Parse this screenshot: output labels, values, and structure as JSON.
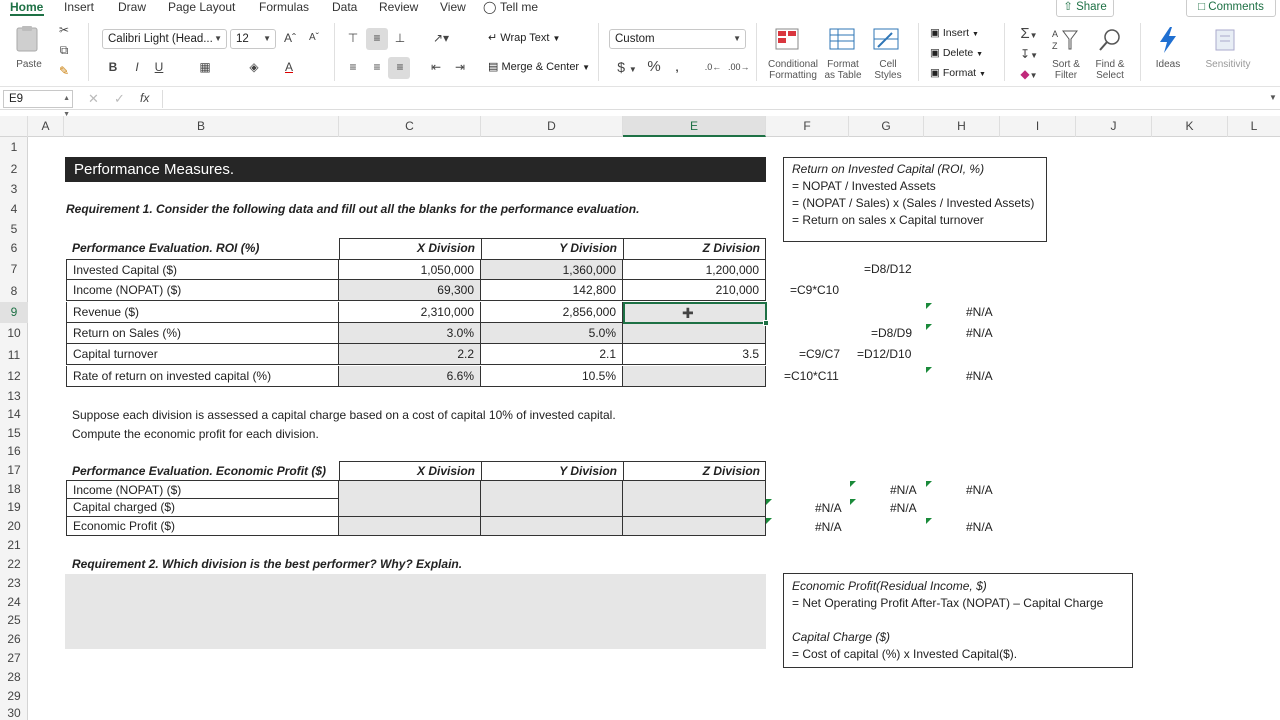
{
  "ribbon_tabs": [
    "Home",
    "Insert",
    "Draw",
    "Page Layout",
    "Formulas",
    "Data",
    "Review",
    "View",
    "Tell me"
  ],
  "share_label": "Share",
  "comments_label": "Comments",
  "ribbon": {
    "paste": "Paste",
    "font_name": "Calibri Light (Head...",
    "font_size": "12",
    "wrap_text": "Wrap Text",
    "merge_center": "Merge & Center",
    "number_format": "Custom",
    "conditional_formatting": [
      "Conditional",
      "Formatting"
    ],
    "format_as_table": [
      "Format",
      "as Table"
    ],
    "cell_styles": [
      "Cell",
      "Styles"
    ],
    "insert": "Insert",
    "delete": "Delete",
    "format": "Format",
    "sort_filter": [
      "Sort &",
      "Filter"
    ],
    "find_select": [
      "Find &",
      "Select"
    ],
    "ideas": "Ideas",
    "sensitivity": "Sensitivity"
  },
  "formula_bar": {
    "name_box": "E9",
    "fx": "fx",
    "content": ""
  },
  "columns": [
    "A",
    "B",
    "C",
    "D",
    "E",
    "F",
    "G",
    "H",
    "I",
    "J",
    "K",
    "L"
  ],
  "selected_column": "E",
  "selected_row": 9,
  "sheet": {
    "title": "Performance Measures.",
    "req1": "Requirement 1. Consider the following data and fill out all the blanks for the performance evaluation.",
    "roi_table": {
      "header": "Performance Evaluation. ROI (%)",
      "cols": [
        "X Division",
        "Y Division",
        "Z Division"
      ],
      "rows": [
        {
          "label": "Invested Capital ($)",
          "vals": [
            "1,050,000",
            "1,360,000",
            "1,200,000"
          ]
        },
        {
          "label": "Income (NOPAT) ($)",
          "vals": [
            "69,300",
            "142,800",
            "210,000"
          ]
        },
        {
          "label": "Revenue ($)",
          "vals": [
            "2,310,000",
            "2,856,000",
            ""
          ]
        },
        {
          "label": "Return on Sales (%)",
          "vals": [
            "3.0%",
            "5.0%",
            ""
          ]
        },
        {
          "label": "Capital turnover",
          "vals": [
            "2.2",
            "2.1",
            "3.5"
          ]
        },
        {
          "label": "Rate of return on invested capital (%)",
          "vals": [
            "6.6%",
            "10.5%",
            ""
          ]
        }
      ]
    },
    "capital_charge_text1": "Suppose each division is assessed a capital charge based on a cost of capital 10% of invested capital.",
    "capital_charge_text2": "Compute the economic profit for each division.",
    "ep_table": {
      "header": "Performance Evaluation. Economic Profit ($)",
      "cols": [
        "X Division",
        "Y Division",
        "Z Division"
      ],
      "rows": [
        "Income (NOPAT) ($)",
        "Capital charged ($)",
        "Economic Profit ($)"
      ]
    },
    "req2": "Requirement 2. Which division is the best performer? Why? Explain.",
    "roi_box": {
      "title": "Return on Invested Capital (ROI, %)",
      "lines": [
        "= NOPAT / Invested Assets",
        "= (NOPAT / Sales) x (Sales / Invested Assets)",
        "= Return on sales x Capital turnover"
      ]
    },
    "ep_box": {
      "title": "Economic Profit(Residual Income, $)",
      "line1": "= Net Operating Profit After-Tax (NOPAT) – Capital Charge",
      "title2": "Capital Charge ($)",
      "line2": "= Cost of capital (%) x Invested Capital($)."
    },
    "side": {
      "g7": "=D8/D12",
      "f8": "=C9*C10",
      "h9": "#N/A",
      "g10": "=D8/D9",
      "h10": "#N/A",
      "f11": "=C9/C7",
      "g11": "=D12/D10",
      "f12": "=C10*C11",
      "h12": "#N/A",
      "g18": "#N/A",
      "h18": "#N/A",
      "f19": "#N/A",
      "g19": "#N/A",
      "f20": "#N/A",
      "h20": "#N/A"
    }
  },
  "colors": {
    "accent": "#1e7145",
    "title_bg": "#262626",
    "shade": "#e6e6e6"
  }
}
